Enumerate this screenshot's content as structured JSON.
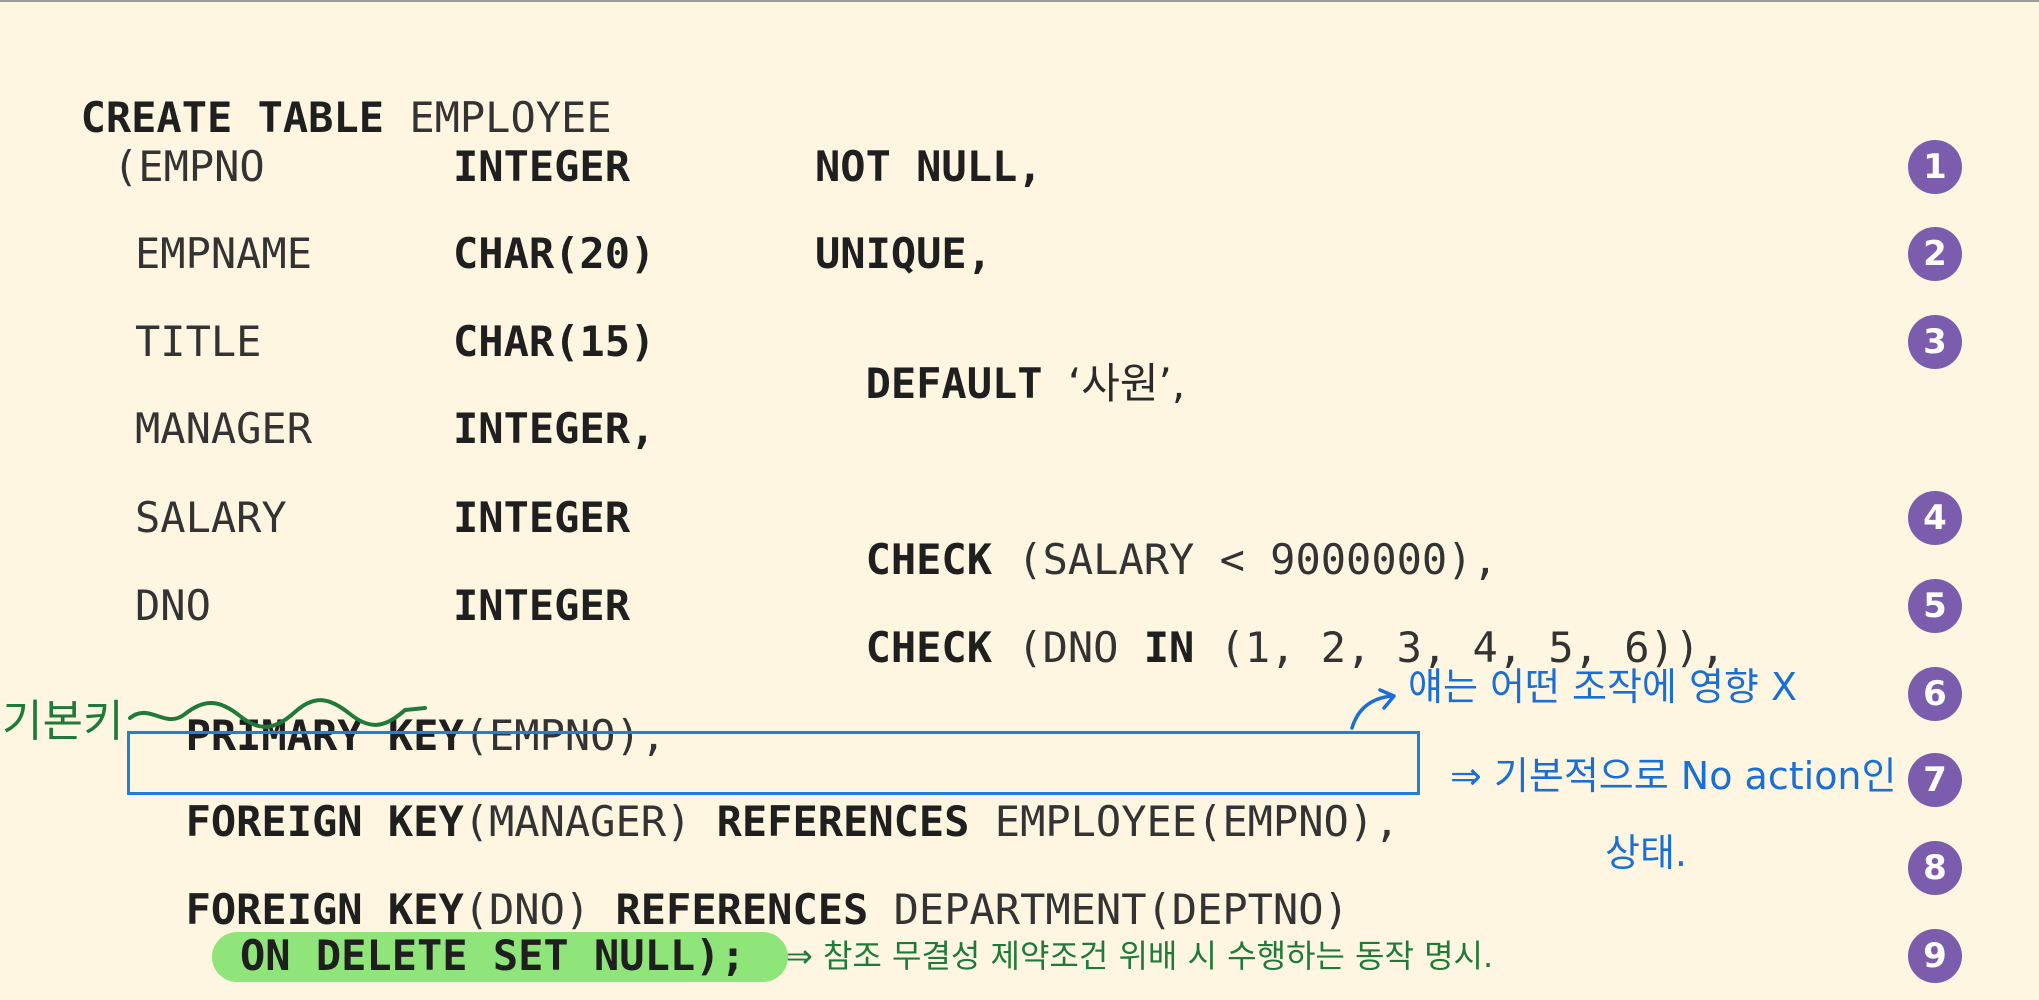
{
  "colors": {
    "background": "#fef6e1",
    "badge": "#7b5cad",
    "highlight": "#8fe47a",
    "annotation_blue": "#1a6fd6",
    "annotation_green": "#1f7a3a"
  },
  "sql": {
    "l0": {
      "kw1": "CREATE TABLE",
      "name": "EMPLOYEE"
    },
    "l1": {
      "col": "(EMPNO",
      "type": "INTEGER",
      "constraint": "NOT NULL,"
    },
    "l2": {
      "col": "EMPNAME",
      "type": "CHAR(20)",
      "constraint": "UNIQUE,"
    },
    "l3": {
      "col": "TITLE",
      "type": "CHAR(15)",
      "kw": "DEFAULT",
      "value": "‘사원’,"
    },
    "l4": {
      "col": "MANAGER",
      "type": "INTEGER,"
    },
    "l5": {
      "col": "SALARY",
      "type": "INTEGER",
      "kw": "CHECK",
      "expr": "(SALARY < 9000000),"
    },
    "l6": {
      "col": "DNO",
      "type": "INTEGER",
      "kw": "CHECK",
      "expr1": "(DNO",
      "kw2": "IN",
      "expr2": "(1, 2, 3, 4, 5, 6)),"
    },
    "l7": {
      "kw": "PRIMARY KEY",
      "rest": "(EMPNO),"
    },
    "l8": {
      "kw": "FOREIGN KEY",
      "mid": "(MANAGER)",
      "kw2": "REFERENCES",
      "rest": "EMPLOYEE(EMPNO),"
    },
    "l9": {
      "kw": "FOREIGN KEY",
      "mid": "(DNO)",
      "kw2": "REFERENCES",
      "rest": "DEPARTMENT(DEPTNO)"
    },
    "l10": {
      "kw": "ON DELETE SET NULL);"
    }
  },
  "badges": [
    "1",
    "2",
    "3",
    "4",
    "5",
    "6",
    "7",
    "8",
    "9"
  ],
  "annotations": {
    "pk_note": "기본키",
    "fk_note_top": "얘는 어떤 조작에 영향 X",
    "fk_note_mid": "⇒ 기본적으로 No action인",
    "fk_note_bottom": "상태.",
    "ondelete_note": "⇒ 참조 무결성 제약조건 위배 시 수행하는 동작 명시."
  }
}
